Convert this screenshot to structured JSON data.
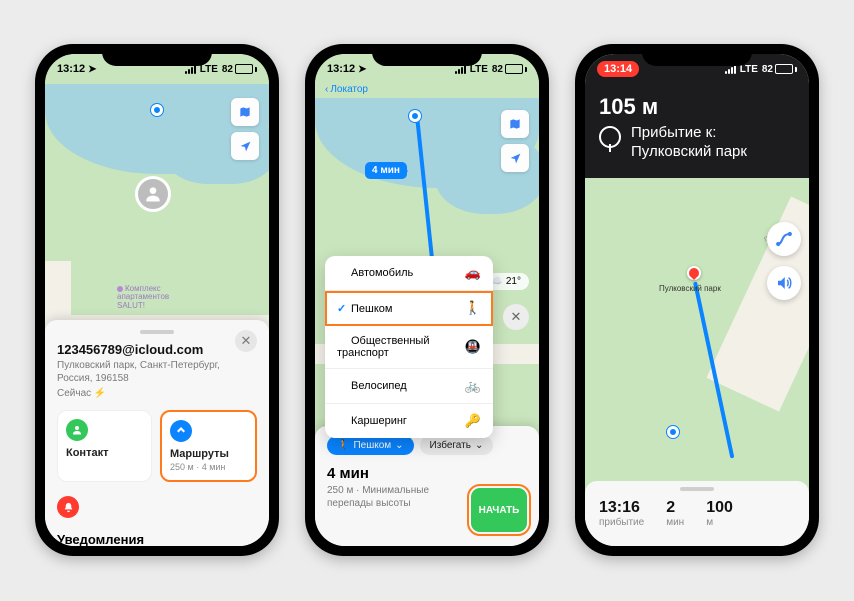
{
  "phone1": {
    "status": {
      "time": "13:12",
      "carrier": "LTE",
      "battery": "82"
    },
    "poi1": {
      "name": "Комплекс\nапартаментов\nSALUT!"
    },
    "sheet": {
      "title": "123456789@icloud.com",
      "subtitle": "Пулковский парк, Санкт-Петербург,\nРоссия, 196158",
      "now": "Сейчас",
      "card_contact": "Контакт",
      "card_routes": "Маршруты",
      "card_routes_sub": "250 м · 4 мин",
      "notifications": "Уведомления"
    }
  },
  "phone2": {
    "status": {
      "time": "13:12",
      "carrier": "LTE",
      "battery": "82"
    },
    "back": "Локатор",
    "eta_bubble": "4 мин",
    "weather": "21°",
    "menu": {
      "car": "Автомобиль",
      "walk": "Пешком",
      "transit": "Общественный\nтранспорт",
      "bike": "Велосипед",
      "carshare": "Каршеринг"
    },
    "chips": {
      "mode": "Пешком",
      "avoid": "Избегать"
    },
    "summary": {
      "title": "4 мин",
      "sub": "250 м · Минимальные\nперепады высоты"
    },
    "go": "НАЧАТЬ"
  },
  "phone3": {
    "status": {
      "time": "13:14",
      "carrier": "LTE",
      "battery": "82"
    },
    "banner": {
      "distance": "105 м",
      "line1": "Прибытие к:",
      "line2": "Пулковский парк"
    },
    "pin_label": "Пулковский парк",
    "street": "пулкo",
    "arrival": {
      "t_val": "13:16",
      "t_lab": "прибытие",
      "m_val": "2",
      "m_lab": "мин",
      "d_val": "100",
      "d_lab": "м"
    }
  }
}
